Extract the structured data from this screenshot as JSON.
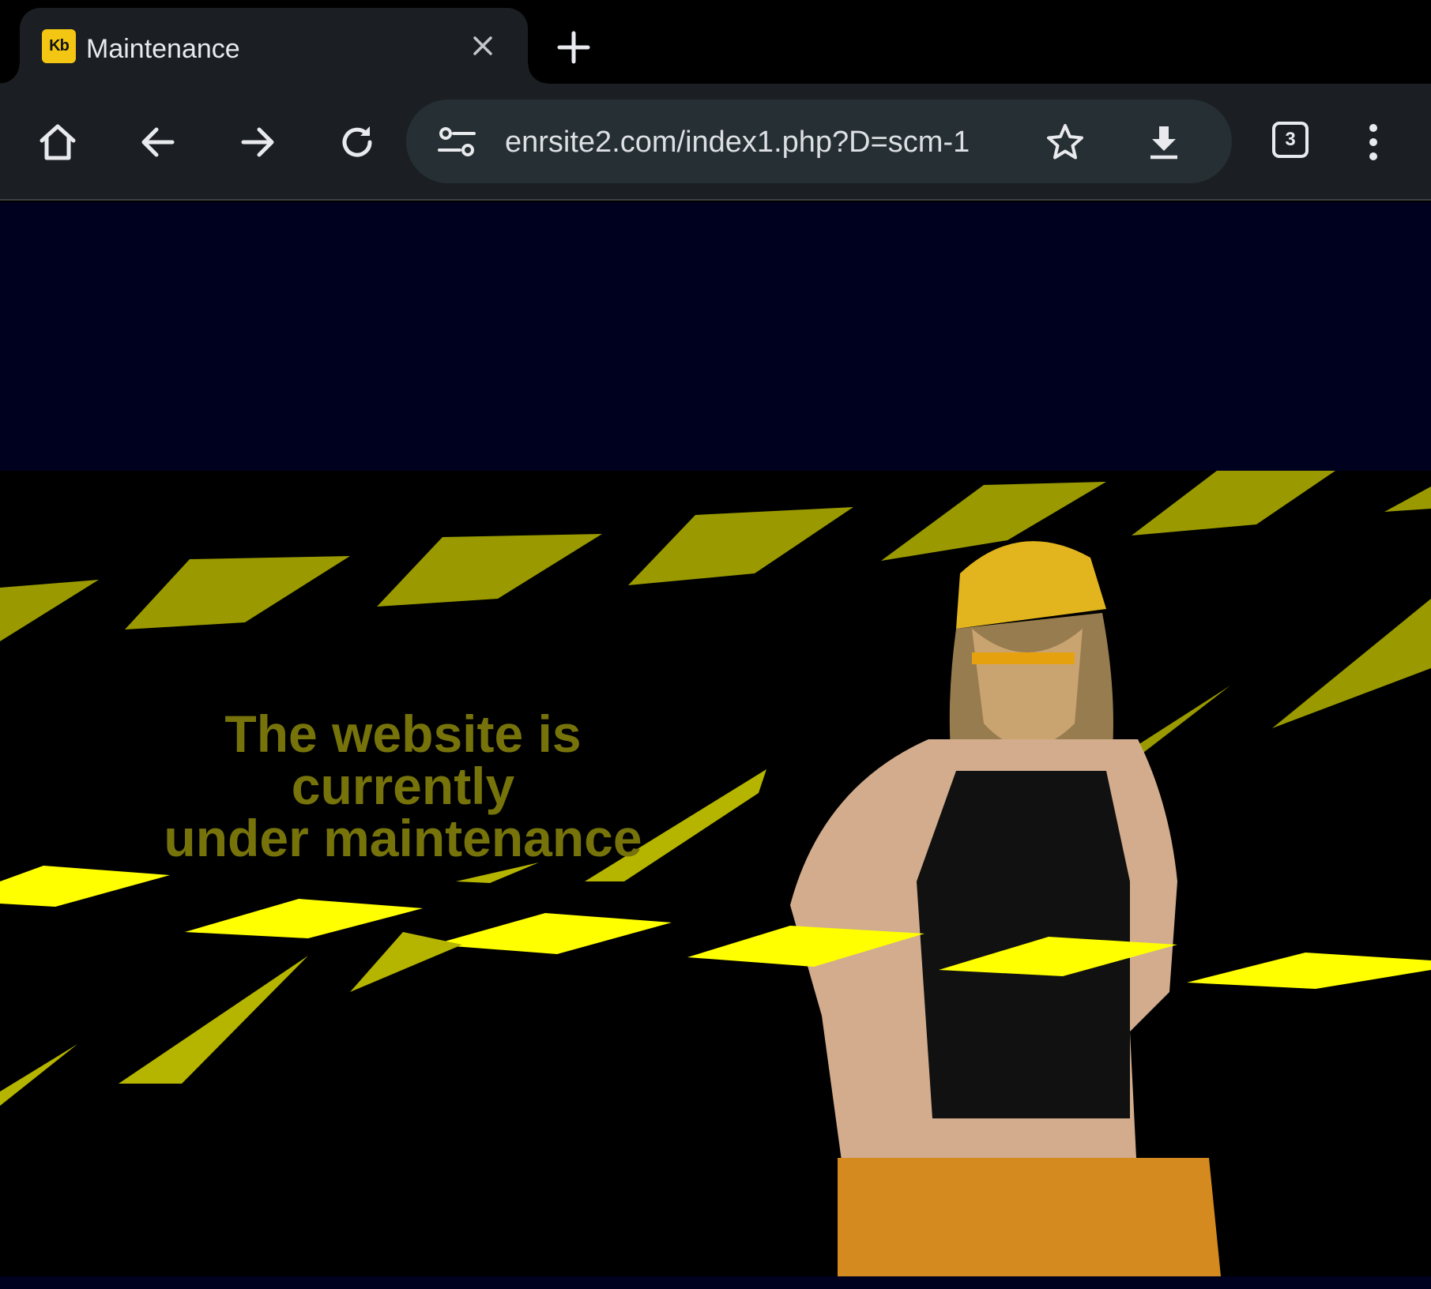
{
  "browser": {
    "tab": {
      "title": "Maintenance",
      "favicon_text": "Kb",
      "favicon_color": "#f3c613"
    },
    "omnibox": {
      "url": "enrsite2.com/index1.php?D=scm-1"
    },
    "tab_count": "3",
    "icons": [
      "home-icon",
      "back-icon",
      "forward-icon",
      "reload-icon",
      "site-info-icon",
      "star-icon",
      "download-icon",
      "more-icon",
      "close-icon",
      "new-tab-icon"
    ]
  },
  "page": {
    "banner": {
      "lines": [
        "The website is",
        "currently",
        "under maintenance"
      ],
      "text_color": "#77730b",
      "tape_color_bright": "#ffff00",
      "tape_color_dim": "#b5b500",
      "image_description_hidden": ""
    }
  }
}
